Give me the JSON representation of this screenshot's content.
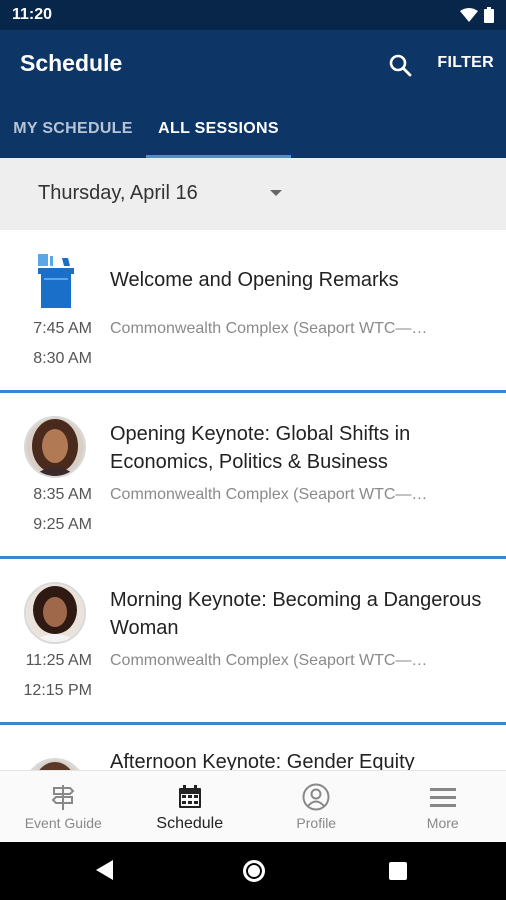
{
  "status_bar": {
    "time": "11:20"
  },
  "app_bar": {
    "title": "Schedule",
    "filter_label": "FILTER"
  },
  "tabs": [
    {
      "label": "MY SCHEDULE"
    },
    {
      "label": "ALL SESSIONS"
    }
  ],
  "date_selector": {
    "value": "Thursday, April 16"
  },
  "sessions": [
    {
      "start": "7:45 AM",
      "end": "8:30 AM",
      "title": "Welcome and Opening Remarks",
      "location": "Commonwealth Complex (Seaport WTC—…",
      "icon": "podium-icon"
    },
    {
      "start": "8:35 AM",
      "end": "9:25 AM",
      "title": "Opening Keynote: Global Shifts in Economics, Politics & Business",
      "location": "Commonwealth Complex (Seaport WTC—…",
      "icon": "speaker-avatar"
    },
    {
      "start": "11:25 AM",
      "end": "12:15 PM",
      "title": "Morning Keynote: Becoming a Dangerous Woman",
      "location": "Commonwealth Complex (Seaport WTC—…",
      "icon": "speaker-avatar"
    },
    {
      "title": "Afternoon Keynote: Gender Equity",
      "icon": "speaker-avatar"
    }
  ],
  "bottom_nav": [
    {
      "label": "Event Guide",
      "icon": "signpost-icon"
    },
    {
      "label": "Schedule",
      "icon": "calendar-icon"
    },
    {
      "label": "Profile",
      "icon": "person-icon"
    },
    {
      "label": "More",
      "icon": "menu-icon"
    }
  ],
  "colors": {
    "status_bar": "#07264a",
    "app_bar": "#0d3566",
    "tab_indicator": "#4a90d9",
    "divider": "#3b87cf"
  }
}
